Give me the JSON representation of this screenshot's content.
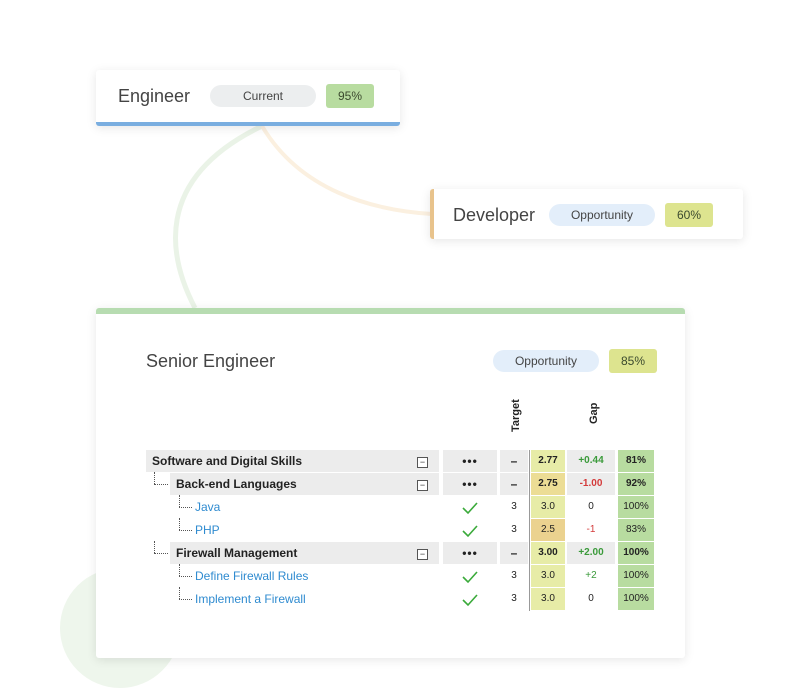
{
  "cards": {
    "engineer": {
      "title": "Engineer",
      "status": "Current",
      "percent": "95%",
      "accent": "#7aaee0"
    },
    "developer": {
      "title": "Developer",
      "status": "Opportunity",
      "percent": "60%",
      "accent": "#e8c38c"
    },
    "senior": {
      "title": "Senior Engineer",
      "status": "Opportunity",
      "percent": "85%",
      "accent": "#b7dcb1"
    }
  },
  "table": {
    "column_headers": {
      "target": "Target",
      "gap": "Gap"
    },
    "rows": [
      {
        "label": "Software and Digital Skills",
        "kind": "group",
        "indent": 0,
        "action": "•••",
        "target": "–",
        "score": "2.77",
        "gap": "+0.44",
        "pct": "81%"
      },
      {
        "label": "Back-end Languages",
        "kind": "group",
        "indent": 1,
        "action": "•••",
        "target": "–",
        "score": "2.75",
        "gap": "-1.00",
        "pct": "92%"
      },
      {
        "label": "Java",
        "kind": "link",
        "indent": 2,
        "action": "check",
        "target": "3",
        "score": "3.0",
        "gap": "0",
        "pct": "100%"
      },
      {
        "label": "PHP",
        "kind": "link",
        "indent": 2,
        "action": "check",
        "target": "3",
        "score": "2.5",
        "gap": "-1",
        "pct": "83%"
      },
      {
        "label": "Firewall Management",
        "kind": "group",
        "indent": 1,
        "action": "•••",
        "target": "–",
        "score": "3.00",
        "gap": "+2.00",
        "pct": "100%"
      },
      {
        "label": "Define Firewall Rules",
        "kind": "link",
        "indent": 2,
        "action": "check",
        "target": "3",
        "score": "3.0",
        "gap": "+2",
        "pct": "100%"
      },
      {
        "label": "Implement a Firewall",
        "kind": "link",
        "indent": 2,
        "action": "check",
        "target": "3",
        "score": "3.0",
        "gap": "0",
        "pct": "100%"
      }
    ]
  },
  "colors": {
    "pct_green": "#b8dca0",
    "pct_yellow": "#dde48f",
    "score_green": "#e7eca7",
    "score_orange": "#ebd28f",
    "gap_positive": "#3a9a3a",
    "gap_negative": "#d43b3b",
    "check": "#3aaa3a"
  }
}
